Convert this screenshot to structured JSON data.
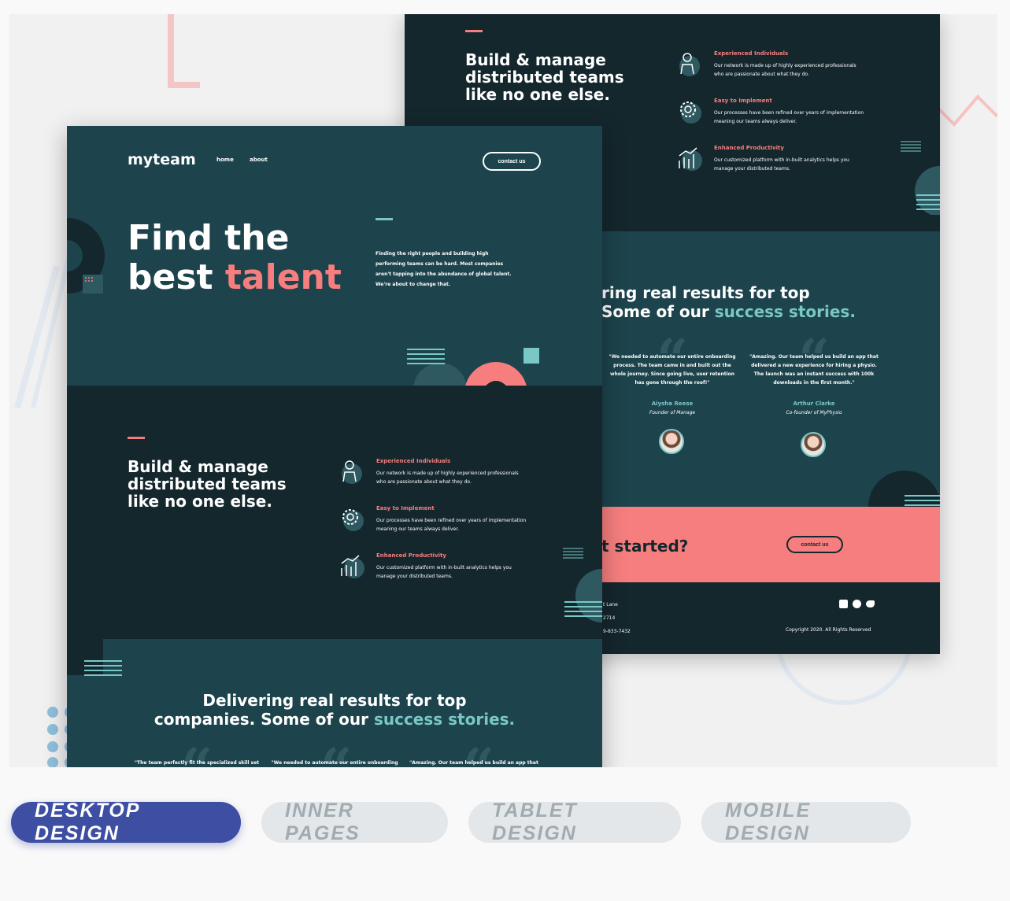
{
  "back": {
    "hero_heading": [
      "Build & manage",
      "distributed teams",
      "like no one else."
    ],
    "features": [
      {
        "title": "Experienced Individuals",
        "desc": [
          "Our network is made up of highly experienced professionals",
          "who are passionate about what they do."
        ],
        "icon": "person-icon"
      },
      {
        "title": "Easy to Implement",
        "desc": [
          "Our processes have been refined over years of implementation",
          "meaning our teams always deliver."
        ],
        "icon": "cog-icon"
      },
      {
        "title": "Enhanced Productivity",
        "desc": [
          "Our customized platform with in-built analytics helps you",
          "manage your distributed teams."
        ],
        "icon": "chart-icon"
      }
    ],
    "results_line1": "ring real results for top",
    "results_line2_prefix": "Some of our ",
    "results_line2_highlight": "success stories.",
    "testimonials": [
      {
        "quote": [
          "\"We needed to automate our entire onboarding",
          "process. The team came in and built out the",
          "whole journey. Since going live, user retention",
          "has gone through the roof!\""
        ],
        "name": "Aiysha Reese",
        "role": "Founder of Manage"
      },
      {
        "quote": [
          "\"Amazing. Our team helped us build an app that",
          "delivered a new experience for hiring a physio.",
          "The launch was an instant success with 100k",
          "downloads in the first month.\""
        ],
        "name": "Arthur Clarke",
        "role": "Co-founder of MyPhysio"
      }
    ],
    "cta_text": "t started?",
    "cta_button": "contact us",
    "footer_address": [
      "t Lane",
      "2714",
      "9-833-7432"
    ],
    "copyright": "Copyright 2020. All Rights Reserved"
  },
  "front": {
    "logo": "myteam",
    "nav": [
      "home",
      "about"
    ],
    "contact_button": "contact us",
    "hero_line1": "Find the",
    "hero_line2_prefix": "best ",
    "hero_line2_highlight": "talent",
    "hero_desc": [
      "Finding the right people and building high",
      "performing teams can be hard. Most companies",
      "aren't tapping into the abundance of global talent.",
      "We're about to change that."
    ],
    "section_heading": [
      "Build & manage",
      "distributed teams",
      "like no one else."
    ],
    "features": [
      {
        "title": "Experienced Individuals",
        "desc": [
          "Our network is made up of highly experienced professionals",
          "who are passionate about what they do."
        ],
        "icon": "person-icon"
      },
      {
        "title": "Easy to Implement",
        "desc": [
          "Our processes have been refined over years of implementation",
          "meaning our teams always deliver."
        ],
        "icon": "cog-icon"
      },
      {
        "title": "Enhanced Productivity",
        "desc": [
          "Our customized platform with in-built analytics helps you",
          "manage your distributed teams."
        ],
        "icon": "chart-icon"
      }
    ],
    "results_line1": "Delivering real results for top",
    "results_line2_prefix": "companies. Some of our ",
    "results_line2_highlight": "success stories.",
    "quotes_snippets": [
      "\"The team perfectly fit the specialized skill set",
      "\"We needed to automate our entire onboarding",
      "\"Amazing. Our team helped us build an app that"
    ]
  },
  "tabs": [
    {
      "label": "DESKTOP DESIGN",
      "active": true
    },
    {
      "label": "INNER PAGES",
      "active": false
    },
    {
      "label": "TABLET DESIGN",
      "active": false
    },
    {
      "label": "MOBILE DESIGN",
      "active": false
    }
  ],
  "colors": {
    "coral": "#f67e7e",
    "mint": "#79c8c7",
    "dark_teal": "#14272d",
    "teal": "#1d434c",
    "tab_active": "#3d4ea3",
    "tab_idle": "#e3e7ea"
  }
}
